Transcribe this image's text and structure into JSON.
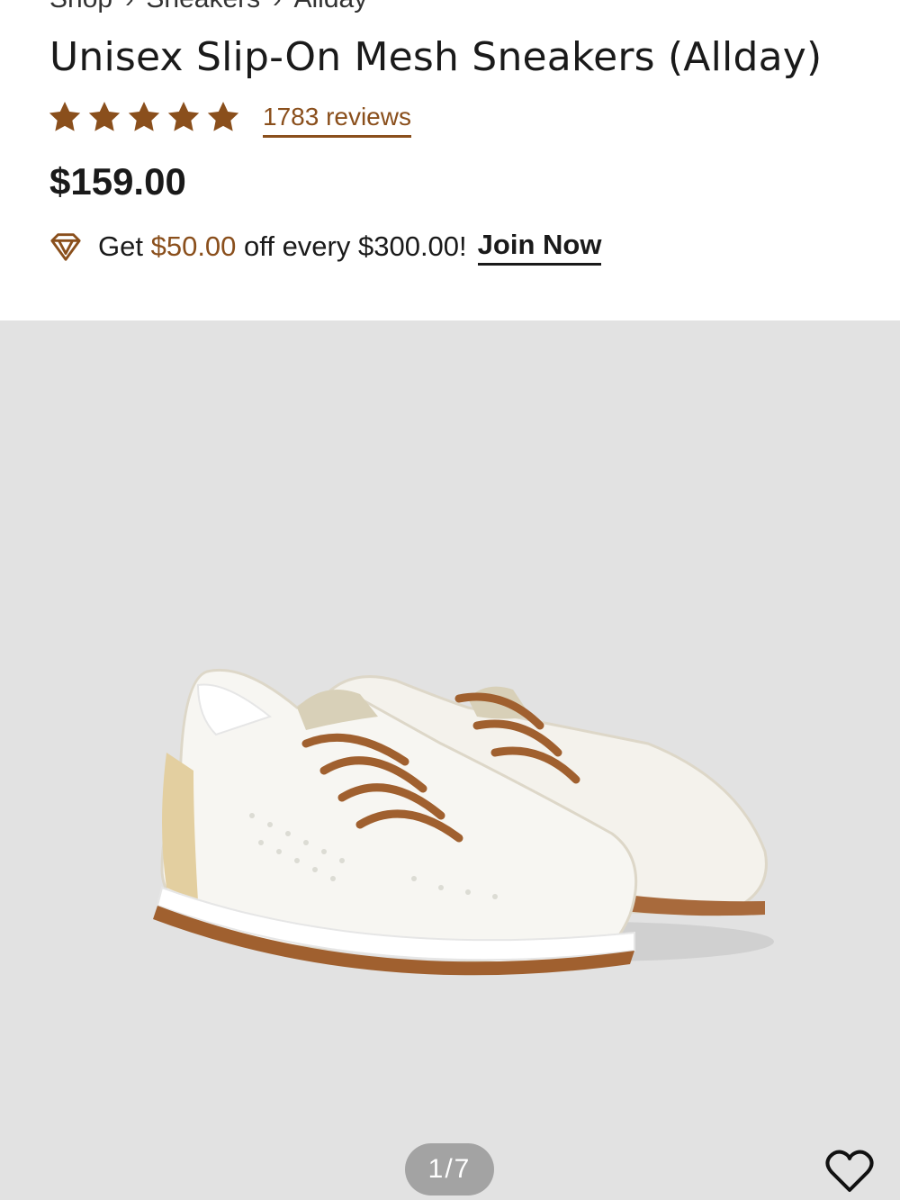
{
  "breadcrumb": {
    "items": [
      "Shop",
      "Sneakers",
      "Allday"
    ],
    "separator": "›"
  },
  "product": {
    "title": "Unisex Slip-On Mesh Sneakers (Allday)",
    "rating": 5,
    "rating_max": 5,
    "reviews_label": "1783 reviews",
    "price": "$159.00"
  },
  "promo": {
    "icon": "diamond-icon",
    "prefix": "Get",
    "amount": "$50.00",
    "suffix": "off every $300.00!",
    "cta": "Join Now"
  },
  "gallery": {
    "counter": "1/7",
    "favorite_icon": "heart-outline-icon"
  },
  "colors": {
    "accent_brown": "#8a4f1c",
    "star": "#8a4f1c",
    "gallery_bg": "#e2e2e2",
    "pager_bg": "#a3a3a3"
  }
}
